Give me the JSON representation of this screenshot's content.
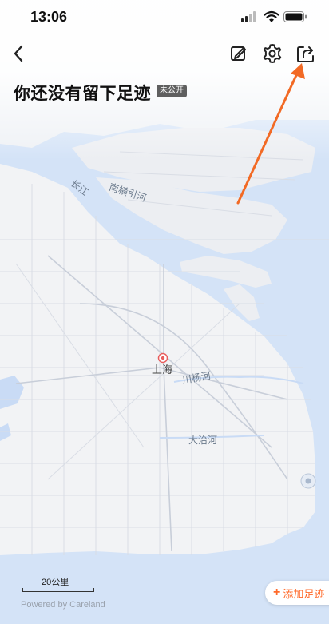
{
  "status_bar": {
    "time": "13:06"
  },
  "header": {
    "title": "你还没有留下足迹",
    "visibility_badge": "未公开"
  },
  "map": {
    "city_label": "上海",
    "river_labels": [
      "长江",
      "南横引河",
      "川杨河",
      "大治河"
    ],
    "scale_label": "20公里",
    "attribution": "Powered by Careland"
  },
  "actions": {
    "add_footprint_label": "添加足迹"
  },
  "colors": {
    "accent": "#ff6a2a",
    "water": "#c9dbf5",
    "land": "#f2f3f5"
  }
}
